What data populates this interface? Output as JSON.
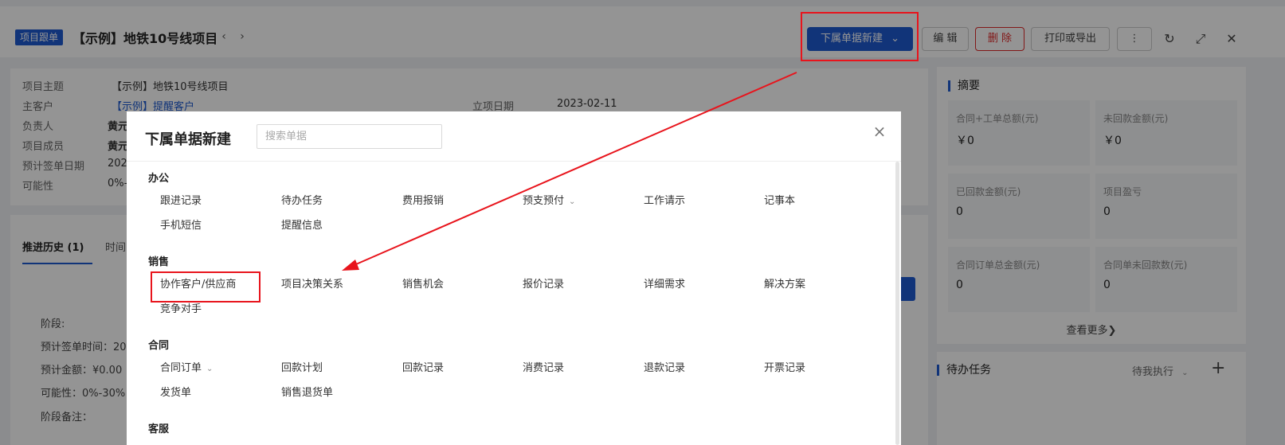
{
  "header": {
    "tag": "项目跟单",
    "title": "【示例】地铁10号线项目",
    "prev": "‹",
    "next": "›",
    "new_sub_label": "下属单据新建",
    "edit_label": "编 辑",
    "delete_label": "删 除",
    "print_label": "打印或导出",
    "more_label": "⋮",
    "refresh_icon": "↻",
    "fullscreen_icon": "⤢",
    "close_icon": "✕"
  },
  "info": {
    "rows": [
      {
        "label": "项目主题",
        "value": "【示例】地铁10号线项目"
      },
      {
        "label": "主客户",
        "value": "【示例】提醒客户"
      },
      {
        "label": "负责人",
        "value": "黄元"
      },
      {
        "label": "项目成员",
        "value": "黄元"
      },
      {
        "label": "预计签单日期",
        "value": "202"
      },
      {
        "label": "可能性",
        "value": "0%-"
      }
    ],
    "date_label": "立项日期",
    "date_value": "2023-02-11"
  },
  "history": {
    "tab_active": "推进历史 (1)",
    "tab_other": "时间",
    "lines": [
      "阶段:",
      "预计签单时间：20",
      "预计金额：¥0.00",
      "可能性：0%-30%",
      "阶段备注："
    ]
  },
  "summary": {
    "title": "摘要",
    "stats": [
      {
        "label": "合同+工单总额(元)",
        "value": "￥0"
      },
      {
        "label": "未回款金额(元)",
        "value": "￥0"
      },
      {
        "label": "已回款金额(元)",
        "value": "0"
      },
      {
        "label": "项目盈亏",
        "value": "0"
      },
      {
        "label": "合同订单总金额(元)",
        "value": "0"
      },
      {
        "label": "合同单未回款数(元)",
        "value": "0"
      }
    ],
    "more": "查看更多❯"
  },
  "todo": {
    "title": "待办任务",
    "filter": "待我执行",
    "add": "+"
  },
  "modal": {
    "title": "下属单据新建",
    "search_placeholder": "搜索单据",
    "close": "×",
    "groups": [
      {
        "title": "办公",
        "items": [
          "跟进记录",
          "待办任务",
          "费用报销",
          "预支预付",
          "工作请示",
          "记事本",
          "手机短信",
          "提醒信息"
        ]
      },
      {
        "title": "销售",
        "items": [
          "协作客户/供应商",
          "项目决策关系",
          "销售机会",
          "报价记录",
          "详细需求",
          "解决方案",
          "竞争对手"
        ]
      },
      {
        "title": "合同",
        "items": [
          "合同订单",
          "回款计划",
          "回款记录",
          "消费记录",
          "退款记录",
          "开票记录",
          "发货单",
          "销售退货单"
        ]
      },
      {
        "title": "客服",
        "items": []
      }
    ]
  },
  "colors": {
    "primary": "#1e5ad0",
    "annotation_red": "#e8141c",
    "danger": "#e02a2a"
  }
}
